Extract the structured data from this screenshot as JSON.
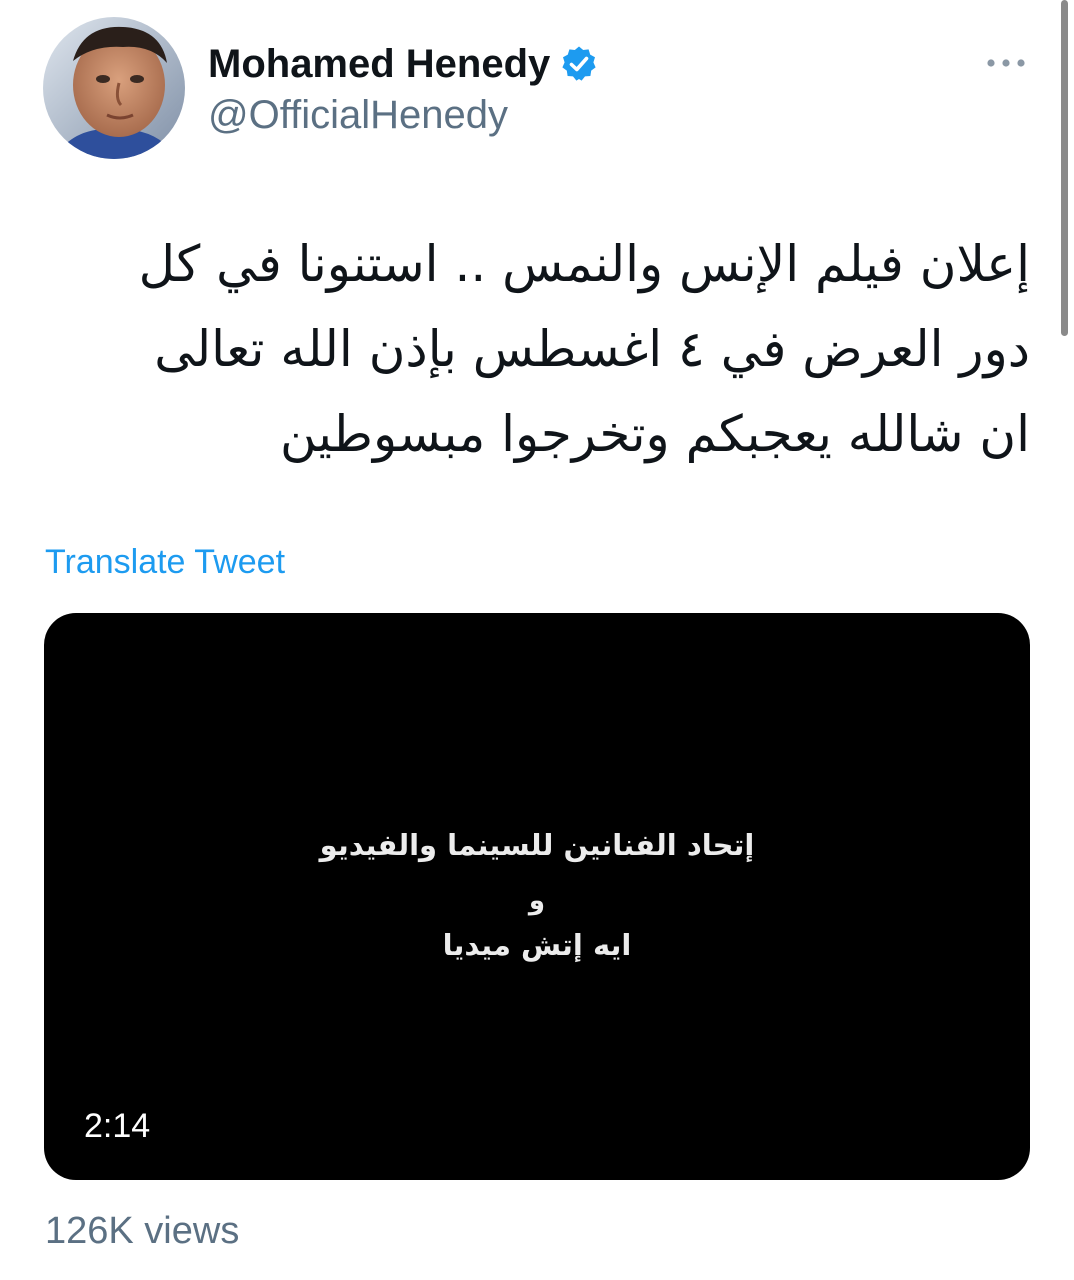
{
  "tweet": {
    "author": {
      "name": "Mohamed Henedy",
      "handle": "@OfficialHenedy",
      "avatar_icon": "avatar-photo",
      "verified_icon": "verified-badge-icon"
    },
    "more_icon": "more-horizontal-icon",
    "text_lines": [
      "إعلان فيلم الإنس والنمس .. استنونا في كل",
      "دور العرض في ٤ اغسطس بإذن الله تعالى",
      "ان شالله يعجبكم وتخرجوا مبسوطين"
    ],
    "translate_label": "Translate Tweet",
    "media": {
      "type": "video",
      "overlay_lines": [
        "إتحاد الفنانين للسينما والفيديو",
        "و",
        "ايه إتش ميديا"
      ],
      "duration": "2:14"
    },
    "views": "126K views"
  },
  "colors": {
    "primary_text": "#0f1419",
    "secondary_text": "#5b7083",
    "accent": "#1d9bf0",
    "media_background": "#000000",
    "background": "#ffffff"
  }
}
